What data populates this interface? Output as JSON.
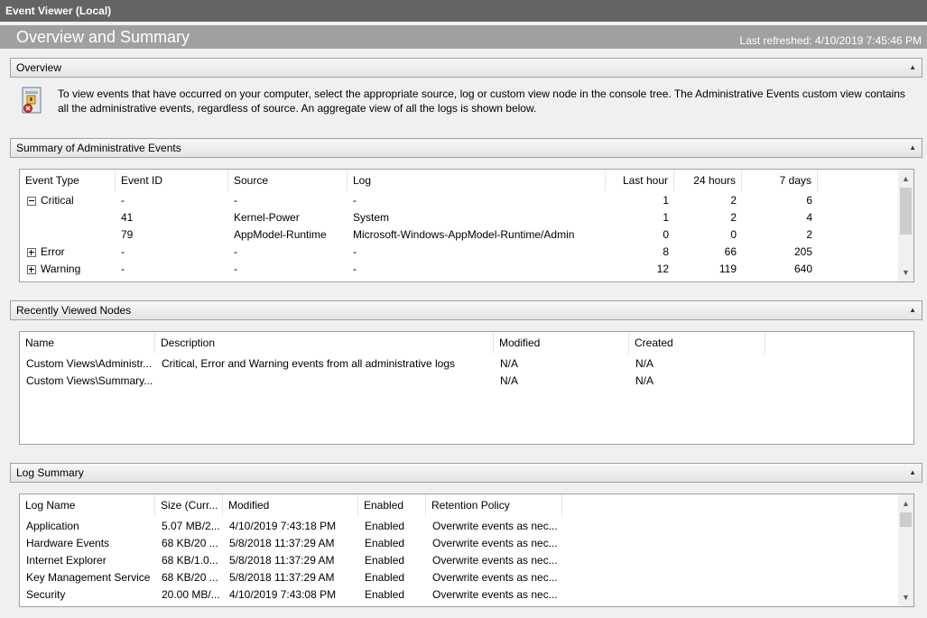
{
  "window": {
    "title": "Event Viewer (Local)"
  },
  "banner": {
    "title": "Overview and Summary",
    "refreshed": "Last refreshed: 4/10/2019 7:45:46 PM"
  },
  "overview": {
    "header": "Overview",
    "text": "To view events that have occurred on your computer, select the appropriate source, log or custom view node in the console tree. The Administrative Events custom view contains all the administrative events, regardless of source. An aggregate view of all the logs is shown below."
  },
  "summary": {
    "header": "Summary of Administrative Events",
    "columns": [
      "Event Type",
      "Event ID",
      "Source",
      "Log",
      "Last hour",
      "24 hours",
      "7 days"
    ],
    "rows": [
      {
        "type": "Critical",
        "id": "-",
        "source": "-",
        "log": "-",
        "hour": "1",
        "day": "2",
        "week": "6"
      },
      {
        "type": "",
        "id": "41",
        "source": "Kernel-Power",
        "log": "System",
        "hour": "1",
        "day": "2",
        "week": "4"
      },
      {
        "type": "",
        "id": "79",
        "source": "AppModel-Runtime",
        "log": "Microsoft-Windows-AppModel-Runtime/Admin",
        "hour": "0",
        "day": "0",
        "week": "2"
      },
      {
        "type": "Error",
        "id": "-",
        "source": "-",
        "log": "-",
        "hour": "8",
        "day": "66",
        "week": "205"
      },
      {
        "type": "Warning",
        "id": "-",
        "source": "-",
        "log": "-",
        "hour": "12",
        "day": "119",
        "week": "640"
      }
    ]
  },
  "recent": {
    "header": "Recently Viewed Nodes",
    "columns": [
      "Name",
      "Description",
      "Modified",
      "Created"
    ],
    "rows": [
      {
        "name": "Custom Views\\Administr...",
        "description": "Critical, Error and Warning events from all administrative logs",
        "modified": "N/A",
        "created": "N/A"
      },
      {
        "name": "Custom Views\\Summary...",
        "description": "",
        "modified": "N/A",
        "created": "N/A"
      }
    ]
  },
  "logsummary": {
    "header": "Log Summary",
    "columns": [
      "Log Name",
      "Size (Curr...",
      "Modified",
      "Enabled",
      "Retention Policy"
    ],
    "rows": [
      {
        "name": "Application",
        "size": "5.07 MB/2...",
        "modified": "4/10/2019 7:43:18 PM",
        "enabled": "Enabled",
        "retention": "Overwrite events as nec..."
      },
      {
        "name": "Hardware Events",
        "size": "68 KB/20 ...",
        "modified": "5/8/2018 11:37:29 AM",
        "enabled": "Enabled",
        "retention": "Overwrite events as nec..."
      },
      {
        "name": "Internet Explorer",
        "size": "68 KB/1.0...",
        "modified": "5/8/2018 11:37:29 AM",
        "enabled": "Enabled",
        "retention": "Overwrite events as nec..."
      },
      {
        "name": "Key Management Service",
        "size": "68 KB/20 ...",
        "modified": "5/8/2018 11:37:29 AM",
        "enabled": "Enabled",
        "retention": "Overwrite events as nec..."
      },
      {
        "name": "Security",
        "size": "20.00 MB/...",
        "modified": "4/10/2019 7:43:08 PM",
        "enabled": "Enabled",
        "retention": "Overwrite events as nec..."
      }
    ]
  },
  "icons": {
    "collapse": "collapse-up-icon",
    "overview": "event-log-icon",
    "expand": "tree-expand-icon",
    "collapse_tree": "tree-collapse-icon"
  },
  "colors": {
    "titlebar": "#646464",
    "banner": "#a0a0a0",
    "section_bg": "#f0f0f0"
  }
}
